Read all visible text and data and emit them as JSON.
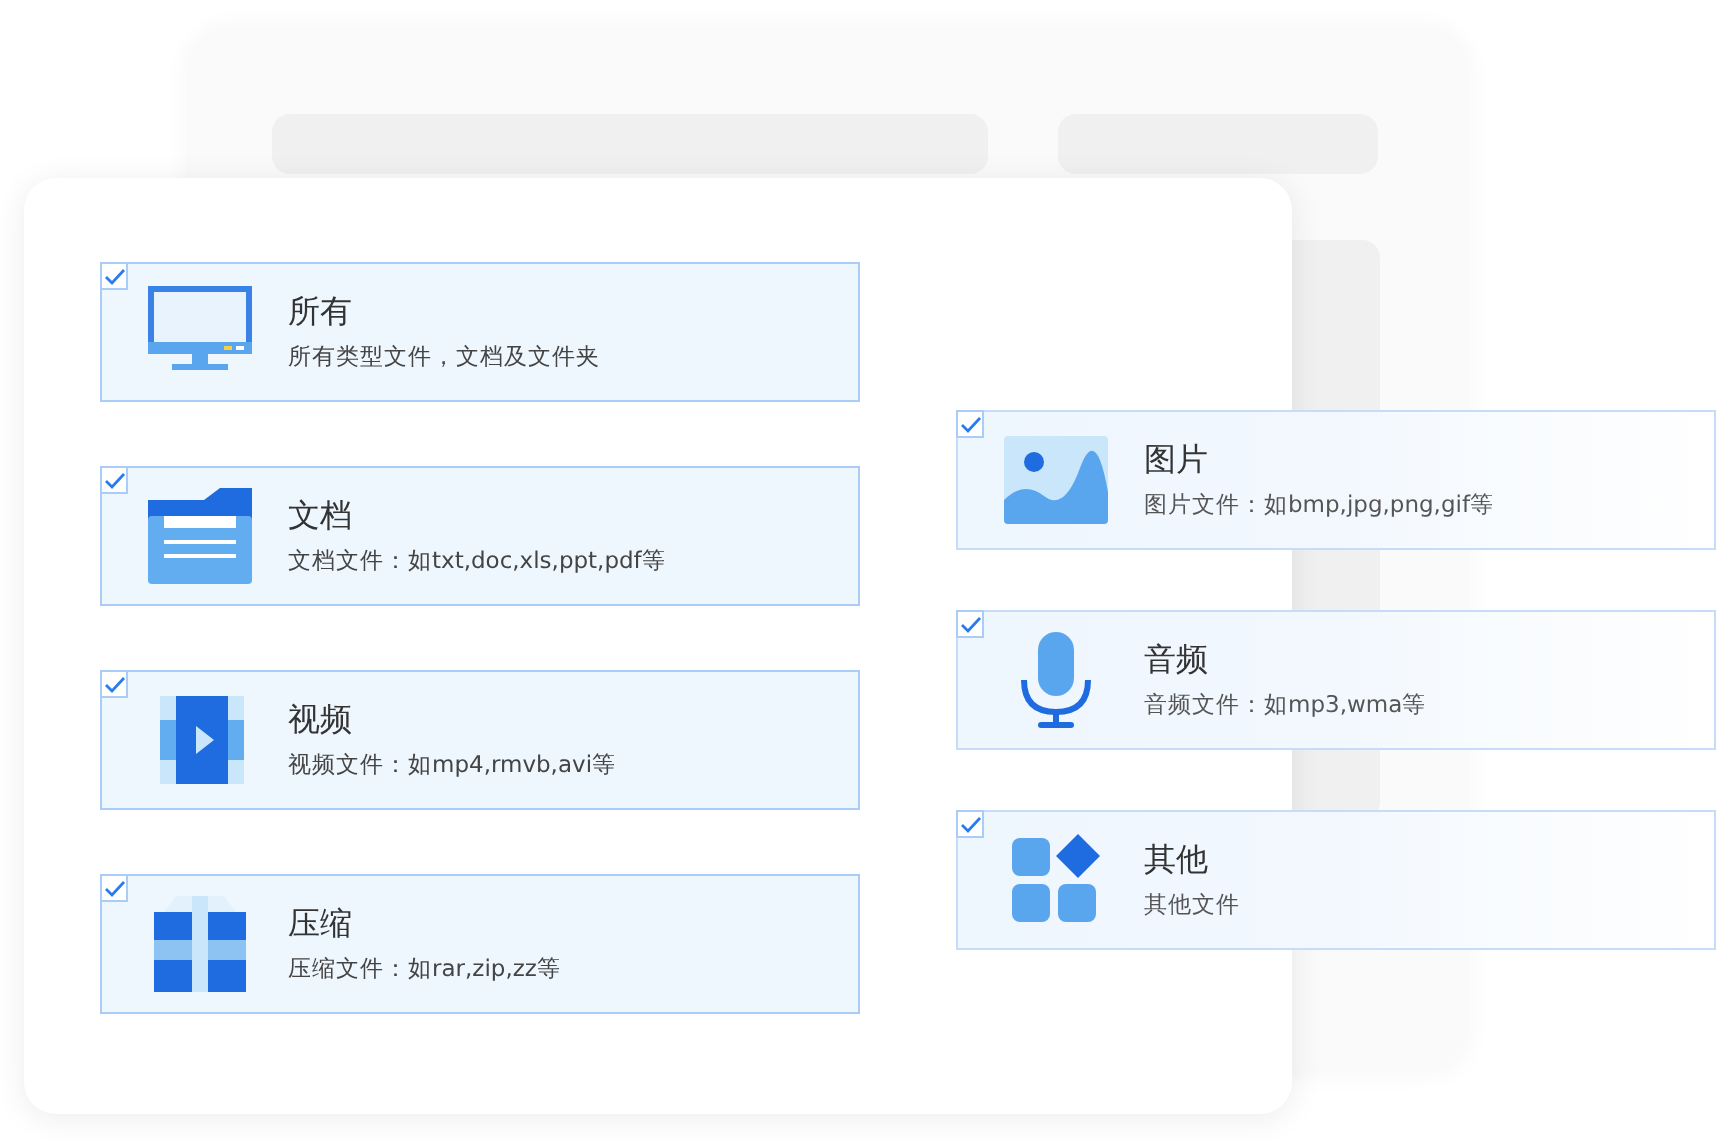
{
  "left_items": [
    {
      "kind": "monitor",
      "title": "所有",
      "description": "所有类型文件，文档及文件夹",
      "checked": true
    },
    {
      "kind": "folder",
      "title": "文档",
      "description": "文档文件：如txt,doc,xls,ppt,pdf等",
      "checked": true
    },
    {
      "kind": "video",
      "title": "视频",
      "description": "视频文件：如mp4,rmvb,avi等",
      "checked": true
    },
    {
      "kind": "archive",
      "title": "压缩",
      "description": "压缩文件：如rar,zip,zz等",
      "checked": true
    }
  ],
  "right_items": [
    {
      "kind": "image",
      "title": "图片",
      "description": "图片文件：如bmp,jpg,png,gif等",
      "checked": true
    },
    {
      "kind": "microphone",
      "title": "音频",
      "description": "音频文件：如mp3,wma等",
      "checked": true
    },
    {
      "kind": "apps",
      "title": "其他",
      "description": "其他文件",
      "checked": true
    }
  ]
}
